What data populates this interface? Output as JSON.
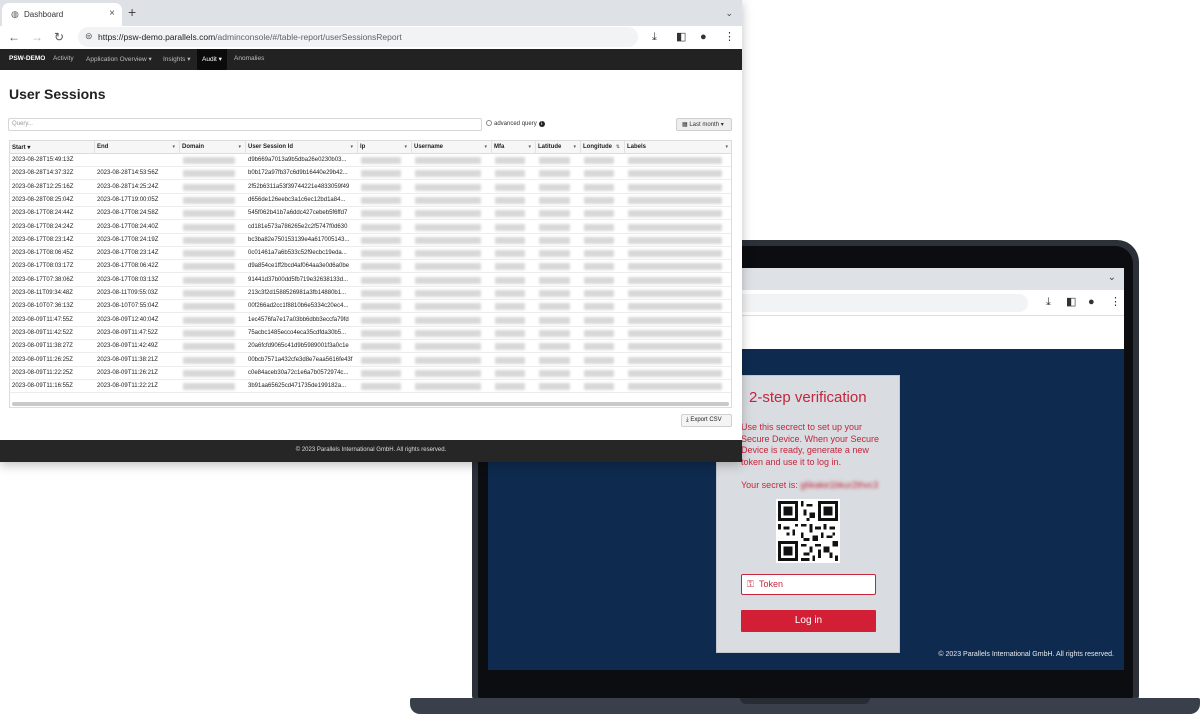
{
  "browser": {
    "tab_title": "Dashboard",
    "url_host": "https://psw-demo.parallels.com",
    "url_path": "/adminconsole/#/table-report/userSessionsReport"
  },
  "app_nav": {
    "brand": "PSW-DEMO",
    "items": [
      "Activity",
      "Application Overview ▾",
      "Insights ▾",
      "Audit ▾",
      "Anomalies"
    ]
  },
  "page": {
    "title": "User Sessions",
    "query_placeholder": "Query...",
    "advanced_query_label": "advanced query",
    "range_label": "Last month ▾",
    "export_label": "Export CSV",
    "footer": "© 2023 Parallels International GmbH. All rights reserved."
  },
  "table": {
    "columns": [
      "Start ▾",
      "End",
      "Domain",
      "User Session Id",
      "Ip",
      "Username",
      "Mfa",
      "Latitude",
      "Longitude",
      "Labels"
    ],
    "rows": [
      [
        "2023-08-28T15:49:13Z",
        "",
        "d9b669a7013a9b5dba26e0230b03..."
      ],
      [
        "2023-08-28T14:37:32Z",
        "2023-08-28T14:53:56Z",
        "b0b172a97fb37c6d9b16440e29b42..."
      ],
      [
        "2023-08-28T12:25:16Z",
        "2023-08-28T14:25:24Z",
        "2f52b6311a53f39744221e4833059f49"
      ],
      [
        "2023-08-28T08:25:04Z",
        "2023-08-17T19:00:05Z",
        "d656de126eebc3a1c6ec12bd1a84..."
      ],
      [
        "2023-08-17T08:24:44Z",
        "2023-08-17T08:24:58Z",
        "545f062b41b7a6ddc427cebeb5f6ffd7"
      ],
      [
        "2023-08-17T08:24:24Z",
        "2023-08-17T08:24:40Z",
        "cd181e573a786265e2c2f5747f0d630"
      ],
      [
        "2023-08-17T08:23:14Z",
        "2023-08-17T08:24:19Z",
        "bc3ba82e750153139e4a617005143..."
      ],
      [
        "2023-08-17T08:06:45Z",
        "2023-08-17T08:23:14Z",
        "0c01461a7a6b533c52f9ecbc19eda..."
      ],
      [
        "2023-08-17T08:03:17Z",
        "2023-08-17T08:06:42Z",
        "d9a854ce1ff2bcd4af064aa3e0d6a0be"
      ],
      [
        "2023-08-17T07:38:06Z",
        "2023-08-17T08:03:13Z",
        "91441d37b00dd5fb719e32638133d..."
      ],
      [
        "2023-08-11T09:34:48Z",
        "2023-08-11T09:55:03Z",
        "213c3f2d1588526981a3fb14880b1..."
      ],
      [
        "2023-08-10T07:36:13Z",
        "2023-08-10T07:55:04Z",
        "00f266ad2cc1f8810b6e5334c20ec4..."
      ],
      [
        "2023-08-09T11:47:55Z",
        "2023-08-09T12:40:04Z",
        "1ec4576fa7e17a03bb6dbb3eccfa79fd"
      ],
      [
        "2023-08-09T11:42:52Z",
        "2023-08-09T11:47:52Z",
        "75acbc1485ecco4eca35cdfda30b5..."
      ],
      [
        "2023-08-09T11:38:27Z",
        "2023-08-09T11:42:49Z",
        "20a6fcfd9065c41d9b5989001f3a0c1e"
      ],
      [
        "2023-08-09T11:26:25Z",
        "2023-08-09T11:38:21Z",
        "00bcb7571a432cfe3d8e7eaa5616fe43f"
      ],
      [
        "2023-08-09T11:22:25Z",
        "2023-08-09T11:26:21Z",
        "c0e84aceb30a72c1e6a7b0572974c..."
      ],
      [
        "2023-08-09T11:16:55Z",
        "2023-08-09T11:22:21Z",
        "3b91aa65625cd471735de199182a..."
      ]
    ]
  },
  "laptop": {
    "title": "2-step verification",
    "instructions": "Use this secrect to set up your Secure Device. When your Secure Device is ready, generate a new token and use it to log in.",
    "secret_label": "Your secret is:",
    "secret_value": "g6kake1bkur2thvc3",
    "token_placeholder": "Token",
    "login_label": "Log in",
    "footer": "© 2023 Parallels International GmbH. All rights reserved."
  },
  "colors": {
    "accent_red": "#d31f35",
    "laptop_bg": "#0e2b4f",
    "nav_bg": "#222222"
  },
  "icons": [
    "globe-icon",
    "close-icon",
    "plus-icon",
    "chevron-down-icon",
    "back-arrow-icon",
    "forward-arrow-icon",
    "reload-icon",
    "lock-icon",
    "download-icon",
    "sidebar-icon",
    "profile-icon",
    "kebab-menu-icon",
    "calendar-icon",
    "info-icon",
    "key-icon"
  ]
}
